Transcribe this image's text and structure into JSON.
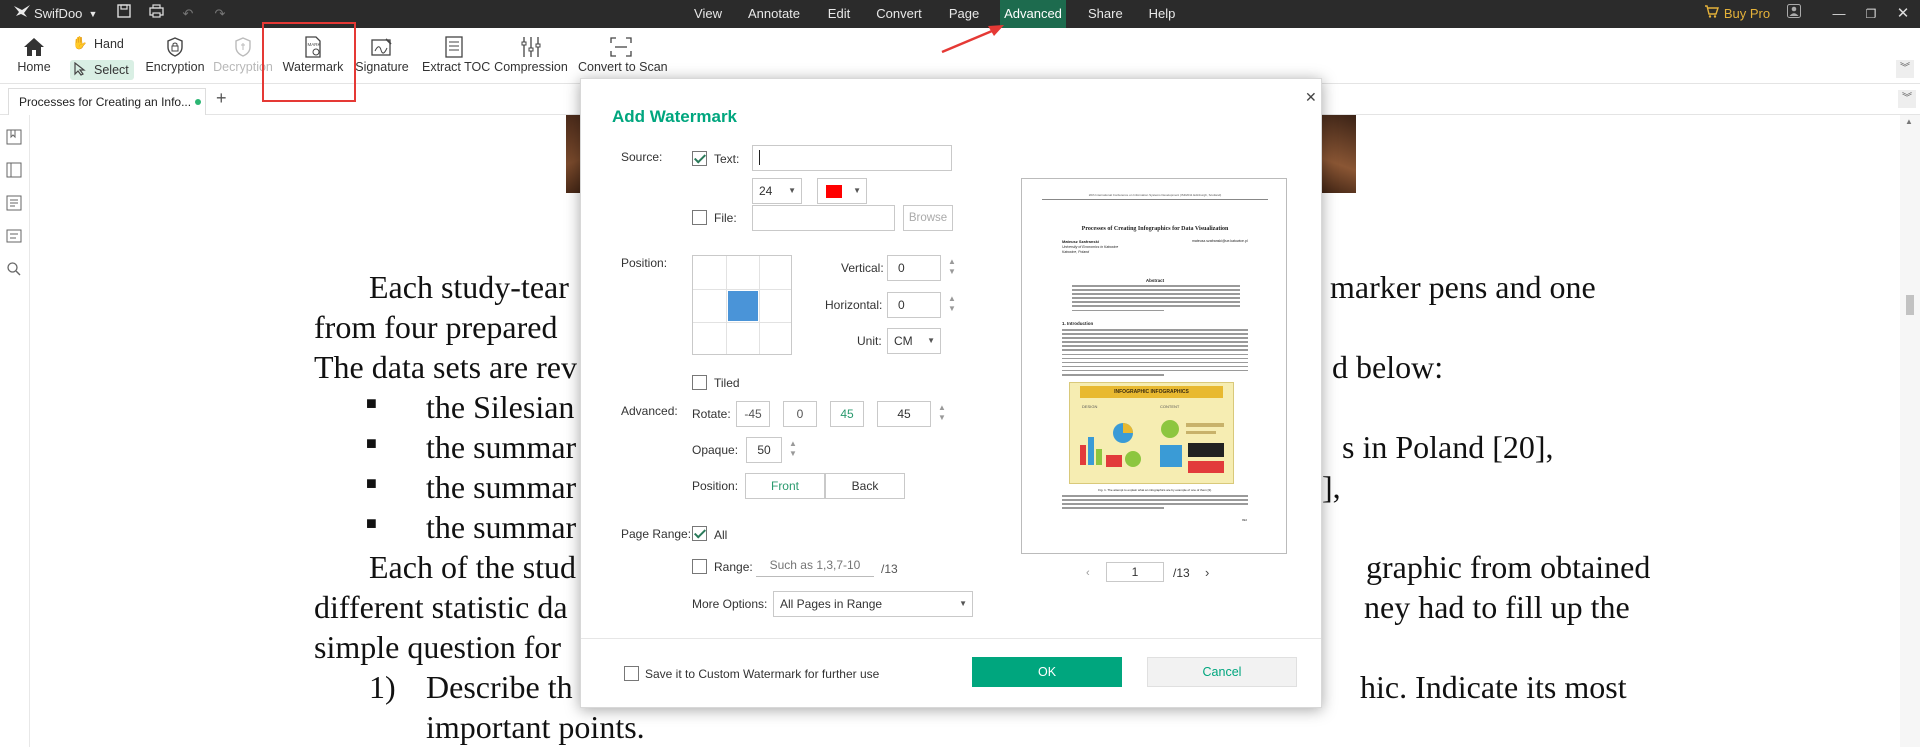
{
  "app": {
    "name": "SwifDoo",
    "menu": [
      "View",
      "Annotate",
      "Edit",
      "Convert",
      "Page",
      "Advanced",
      "Share",
      "Help"
    ],
    "active_menu": "Advanced",
    "buy_pro": "Buy Pro",
    "accent": "#1d6b4e",
    "brand_green": "#00a67e"
  },
  "toolbar": {
    "home": "Home",
    "hand": "Hand",
    "select": "Select",
    "encryption": "Encryption",
    "decryption": "Decryption",
    "watermark": "Watermark",
    "signature": "Signature",
    "extract_toc": "Extract TOC",
    "compression": "Compression",
    "convert_to_scan": "Convert to Scan"
  },
  "tab": {
    "title": "Processes for Creating an Info...",
    "add": "+"
  },
  "document": {
    "lines": [
      "Each study-tear",
      "marker pens and one",
      "from four prepared",
      "The data sets are rev",
      "d below:",
      "the Silesian",
      "the summar",
      "s in Poland [20],",
      "the summar",
      "],",
      "the summar",
      "Each of the stud",
      "graphic from obtained",
      "different statistic da",
      "ney had to fill up the",
      "simple question for",
      "1)",
      "Describe th",
      "hic. Indicate its most",
      "important points."
    ],
    "bullet": "■"
  },
  "dialog": {
    "title": "Add Watermark",
    "source_label": "Source:",
    "text_label": "Text:",
    "text_value": "",
    "font_size": "24",
    "color": "#ff0000",
    "text_checked": true,
    "file_label": "File:",
    "file_value": "",
    "browse": "Browse",
    "file_checked": false,
    "position_label": "Position:",
    "vertical_label": "Vertical:",
    "vertical_value": "0",
    "horizontal_label": "Horizontal:",
    "horizontal_value": "0",
    "unit_label": "Unit:",
    "unit_value": "CM",
    "tiled_label": "Tiled",
    "tiled_checked": false,
    "advanced_label": "Advanced:",
    "rotate_label": "Rotate:",
    "rotate_presets": [
      "-45",
      "0",
      "45"
    ],
    "rotate_value": "45",
    "opaque_label": "Opaque:",
    "opaque_value": "50",
    "layer_label": "Position:",
    "front": "Front",
    "back": "Back",
    "page_range_label": "Page Range:",
    "all_label": "All",
    "all_checked": true,
    "range_label": "Range:",
    "range_placeholder": "Such as 1,3,7-10",
    "range_total": "/13",
    "more_options_label": "More Options:",
    "more_options_value": "All Pages in Range",
    "preview_page": "1",
    "preview_total": "/13",
    "save_custom": "Save it to Custom Watermark for further use",
    "ok": "OK",
    "cancel": "Cancel"
  },
  "preview": {
    "header": "20th International Conference on Information Systems Development (ISD2011 Edinburgh, Scotland)",
    "title": "Processes of Creating Infographics for Data Visualization",
    "author": "Mateusz Szafranski",
    "affil": "University of Economics in Katowice",
    "affil2": "Katowice, Poland",
    "email": "mateusz.szafranski@ue.katowice.pl",
    "abstract_head": "Abstract",
    "intro_head": "1. Introduction",
    "infographic_title": "INFOGRAPHIC INFOGRAPHICS",
    "infographic_sub1": "DESIGN",
    "infographic_sub2": "CONTENT",
    "fig_caption": "Fig. 1. The attempt to explain what an infographics are by example of one of them [3].",
    "page_no": "992"
  }
}
